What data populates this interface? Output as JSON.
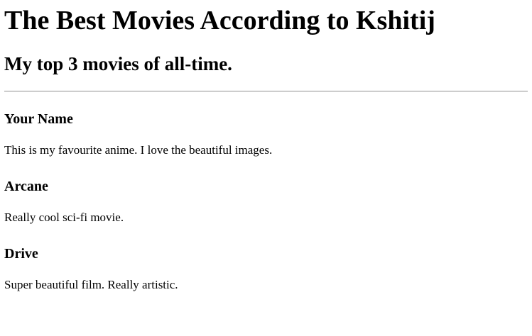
{
  "page": {
    "title": "The Best Movies According to Kshitij",
    "subtitle": "My top 3 movies of all-time."
  },
  "movies": [
    {
      "name": "Your Name",
      "description": "This is my favourite anime. I love the beautiful images."
    },
    {
      "name": "Arcane",
      "description": "Really cool sci-fi movie."
    },
    {
      "name": "Drive",
      "description": "Super beautiful film. Really artistic."
    }
  ]
}
